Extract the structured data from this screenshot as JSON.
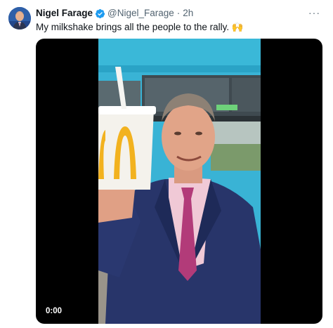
{
  "author": {
    "display_name": "Nigel Farage",
    "handle": "@Nigel_Farage",
    "separator": "·",
    "timestamp": "2h"
  },
  "tweet": {
    "text": "My milkshake brings all the people to the rally. 🙌"
  },
  "video": {
    "elapsed_time": "0:00"
  },
  "colors": {
    "verified_badge": "#1d9bf0",
    "text_primary": "#0f1419",
    "text_secondary": "#536471",
    "media_background": "#000000"
  },
  "icons": {
    "verified": "verified-badge-icon",
    "more": "more-options-icon"
  },
  "more_label": "···"
}
